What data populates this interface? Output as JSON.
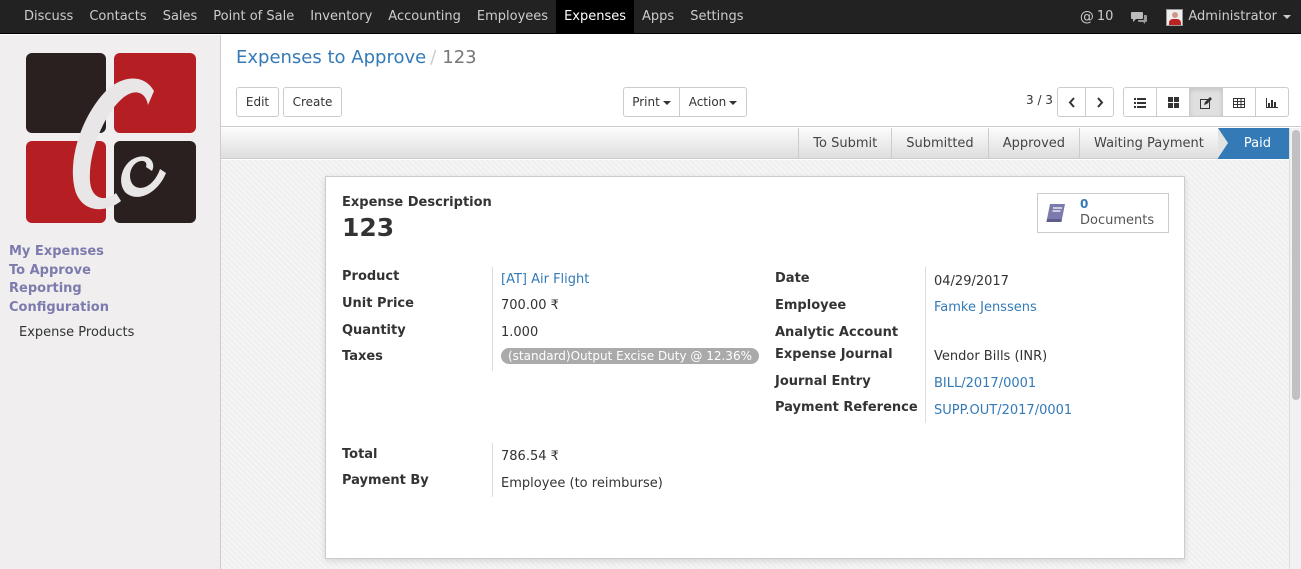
{
  "topbar": {
    "menu": [
      "Discuss",
      "Contacts",
      "Sales",
      "Point of Sale",
      "Inventory",
      "Accounting",
      "Employees",
      "Expenses",
      "Apps",
      "Settings"
    ],
    "active_menu": "Expenses",
    "notifications": "10",
    "user": "Administrator"
  },
  "sidebar": {
    "sections": [
      "My Expenses",
      "To Approve",
      "Reporting",
      "Configuration"
    ],
    "sub_item": "Expense Products"
  },
  "breadcrumb": {
    "parent": "Expenses to Approve",
    "current": "123"
  },
  "buttons": {
    "edit": "Edit",
    "create": "Create",
    "print": "Print",
    "action": "Action"
  },
  "pager": {
    "value": "3 / 3"
  },
  "stages": [
    "To Submit",
    "Submitted",
    "Approved",
    "Waiting Payment",
    "Paid"
  ],
  "active_stage": "Paid",
  "smart_button": {
    "count": "0",
    "label": "Documents"
  },
  "form": {
    "description_label": "Expense Description",
    "description": "123",
    "left": {
      "product_label": "Product",
      "product": "[AT] Air Flight",
      "unit_price_label": "Unit Price",
      "unit_price": "700.00 ₹",
      "quantity_label": "Quantity",
      "quantity": "1.000",
      "taxes_label": "Taxes",
      "taxes": "(standard)Output Excise Duty @ 12.36%"
    },
    "right": {
      "date_label": "Date",
      "date": "04/29/2017",
      "employee_label": "Employee",
      "employee": "Famke Jenssens",
      "analytic_label": "Analytic Account",
      "analytic": "",
      "journal_label": "Expense Journal",
      "journal": "Vendor Bills (INR)",
      "entry_label": "Journal Entry",
      "entry": "BILL/2017/0001",
      "payref_label": "Payment Reference",
      "payref": "SUPP.OUT/2017/0001"
    },
    "bottom": {
      "total_label": "Total",
      "total": "786.54 ₹",
      "payment_by_label": "Payment By",
      "payment_by": "Employee (to reimburse)"
    }
  },
  "colors": {
    "brand_red": "#b51f24",
    "link": "#337ab7",
    "sidebar_section": "#7c7bad",
    "navbar": "#222222"
  }
}
